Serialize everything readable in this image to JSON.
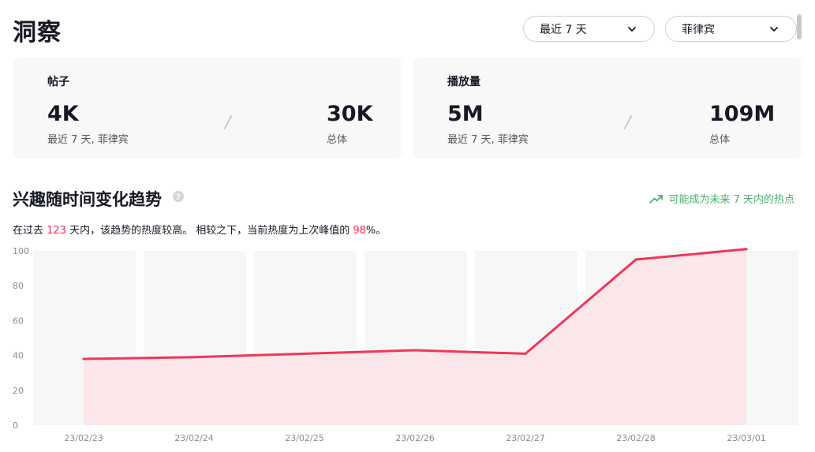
{
  "page": {
    "title": "洞察"
  },
  "filters": {
    "range": {
      "value": "最近 7 天"
    },
    "region": {
      "value": "菲律宾"
    }
  },
  "cards": {
    "posts": {
      "label": "帖子",
      "recent_value": "4K",
      "recent_caption": "最近 7 天, 菲律宾",
      "total_value": "30K",
      "total_caption": "总体"
    },
    "views": {
      "label": "播放量",
      "recent_value": "5M",
      "recent_caption": "最近 7 天, 菲律宾",
      "total_value": "109M",
      "total_caption": "总体"
    }
  },
  "trend": {
    "title": "兴趣随时间变化趋势",
    "hot_label": "可能成为未来 7 天内的热点",
    "desc_prefix": "在过去 ",
    "desc_days": "123",
    "desc_middle": " 天内，该趋势的热度较高。 相较之下，当前热度为上次峰值的 ",
    "desc_percent": "98",
    "desc_suffix": "%。"
  },
  "colors": {
    "accent": "#fe2c55",
    "line": "#f0365a",
    "area": "#fbe3e8",
    "hot": "#49b06a",
    "band": "#f7f7f7"
  },
  "chart_data": {
    "type": "area",
    "x": [
      "23/02/23",
      "23/02/24",
      "23/02/25",
      "23/02/26",
      "23/02/27",
      "23/02/28",
      "23/03/01"
    ],
    "series": [
      {
        "values": [
          38,
          39,
          41,
          43,
          41,
          95,
          101
        ]
      }
    ],
    "yticks": [
      0,
      20,
      40,
      60,
      80,
      100
    ],
    "ylim": [
      0,
      100
    ],
    "xlabel": "",
    "ylabel": "",
    "title": "",
    "grid": false
  }
}
